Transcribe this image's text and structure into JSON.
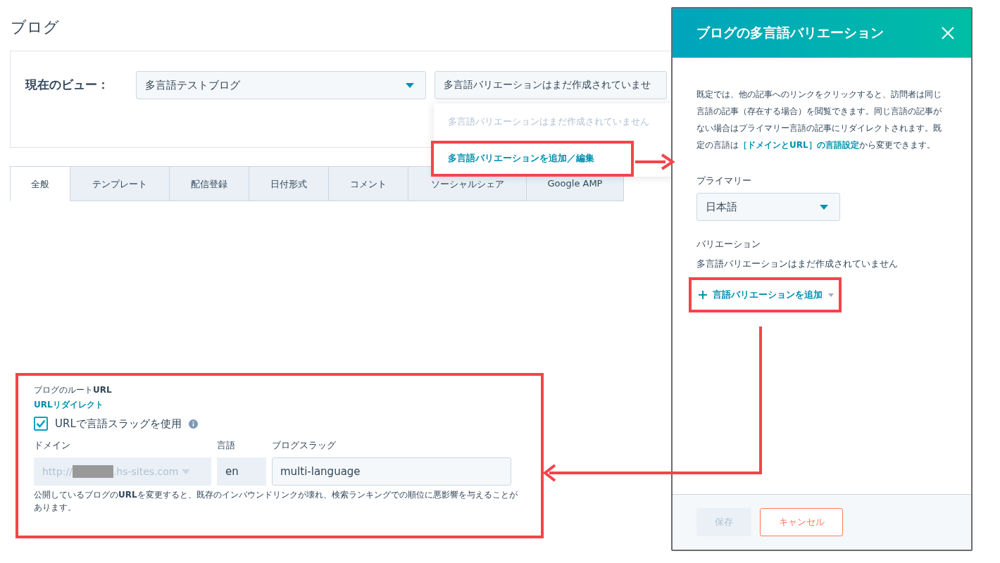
{
  "page": {
    "title": "ブログ"
  },
  "view_bar": {
    "label": "現在のビュー：",
    "blog_select": {
      "value": "多言語テストブログ"
    },
    "variation_select": {
      "value": "多言語バリエーションはまだ作成されていませ"
    },
    "dropdown_items": [
      {
        "label": "多言語バリエーションはまだ作成されていません",
        "disabled": true,
        "highlighted": false
      },
      {
        "label": "多言語バリエーションを追加／編集",
        "disabled": false,
        "highlighted": true
      }
    ]
  },
  "tabs": [
    {
      "label": "全般",
      "selected": true
    },
    {
      "label": "テンプレート",
      "selected": false
    },
    {
      "label": "配信登録",
      "selected": false
    },
    {
      "label": "日付形式",
      "selected": false
    },
    {
      "label": "コメント",
      "selected": false
    },
    {
      "label": "ソーシャルシェア",
      "selected": false
    },
    {
      "label": "Google AMP",
      "selected": false
    }
  ],
  "url_settings": {
    "highlighted": true,
    "title": "ブログのルート**URL**",
    "redirect_link": "URLリダイレクト",
    "use_slug": {
      "label": "URLで言語スラッグを使用",
      "checked": true
    },
    "domain": {
      "label": "ドメイン",
      "prefix": "http://",
      "suffix": ".hs-sites.com",
      "disabled": true
    },
    "language": {
      "label": "言語",
      "value": "en"
    },
    "slug": {
      "label": "ブログスラッグ",
      "value": "multi-language"
    },
    "note": "公開しているブログの**URL**を変更すると、既存のインバウンドリンクが壊れ、検索ランキングでの順位に悪影響を与えることがあります。"
  },
  "panel": {
    "title": "ブログの多言語バリエーション",
    "description": {
      "before": "既定では、他の記事へのリンクをクリックすると、訪問者は同じ言語の記事（存在する場合）を閲覧できます。同じ言語の記事がない場合はプライマリー言語の記事にリダイレクトされます。既定の言語は",
      "link": "［ドメインとURL］の言語設定",
      "after": "から変更できます。"
    },
    "primary_label": "プライマリー",
    "primary_value": "日本語",
    "variations_label": "バリエーション",
    "variations_empty": "多言語バリエーションはまだ作成されていません",
    "add_button": {
      "label": "言語バリエーションを追加",
      "highlighted": true
    },
    "save_button": {
      "label": "保存",
      "disabled": true
    },
    "cancel_button": {
      "label": "キャンセル"
    }
  }
}
